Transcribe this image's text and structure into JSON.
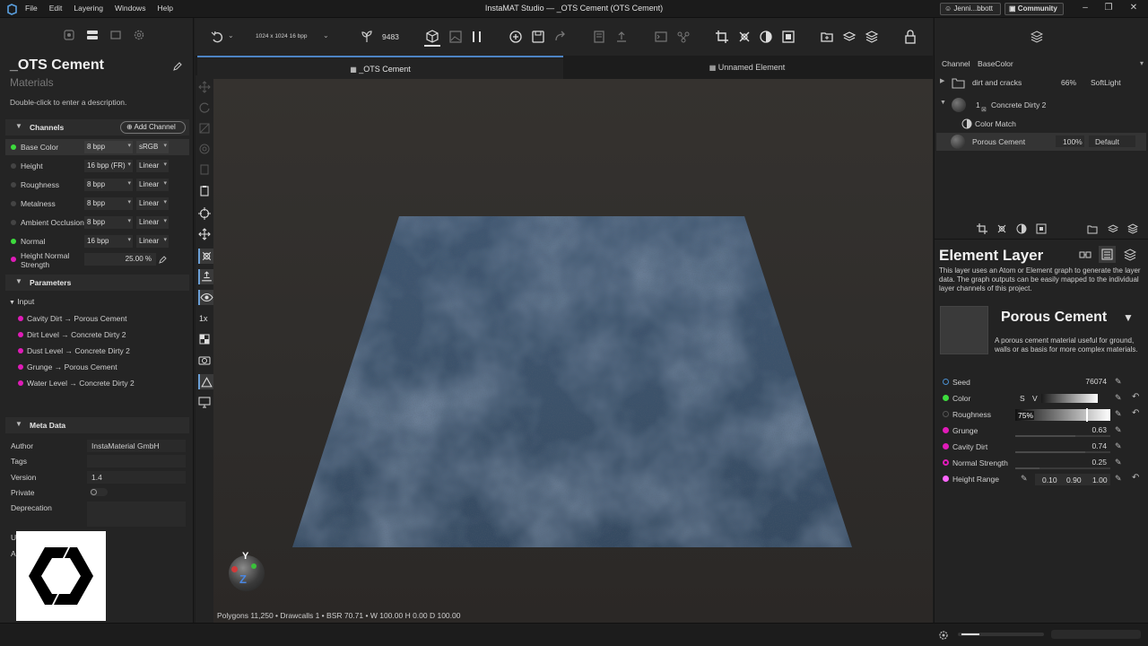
{
  "app": {
    "title": "InstaMAT Studio — _OTS Cement (OTS Cement)",
    "menu": [
      "File",
      "Edit",
      "Layering",
      "Windows",
      "Help"
    ],
    "user_label": "Jenni...bbott",
    "community_label": "Community"
  },
  "document": {
    "title": "_OTS Cement",
    "subtitle": "Materials",
    "description": "Double-click to enter a description."
  },
  "channels": {
    "header": "Channels",
    "add_label": "Add Channel",
    "items": [
      {
        "name": "Base Color",
        "bpp": "8 bpp",
        "space": "sRGB",
        "dot": "#3ddc3d",
        "selected": true
      },
      {
        "name": "Height",
        "bpp": "16 bpp (FR)",
        "space": "Linear",
        "dot": "#444444",
        "selected": false
      },
      {
        "name": "Roughness",
        "bpp": "8 bpp",
        "space": "Linear",
        "dot": "#444444",
        "selected": false
      },
      {
        "name": "Metalness",
        "bpp": "8 bpp",
        "space": "Linear",
        "dot": "#444444",
        "selected": false
      },
      {
        "name": "Ambient Occlusion",
        "bpp": "8 bpp",
        "space": "Linear",
        "dot": "#444444",
        "selected": false
      },
      {
        "name": "Normal",
        "bpp": "16 bpp",
        "space": "Linear",
        "dot": "#3ddc3d",
        "selected": false
      }
    ],
    "height_normal": {
      "label_line1": "Height Normal",
      "label_line2": "Strength",
      "value": "25.00 %"
    }
  },
  "parameters": {
    "header": "Parameters",
    "group": "Input",
    "items": [
      "Cavity Dirt → Porous Cement",
      "Dirt Level → Concrete Dirty 2",
      "Dust Level → Concrete Dirty 2",
      "Grunge → Porous Cement",
      "Water Level → Concrete Dirty 2"
    ]
  },
  "metadata": {
    "header": "Meta Data",
    "author_label": "Author",
    "author": "InstaMaterial GmbH",
    "tags_label": "Tags",
    "tags": "",
    "version_label": "Version",
    "version": "1.4",
    "private_label": "Private",
    "deprecation_label": "Deprecation",
    "u_label": "U",
    "a_label": "A"
  },
  "toolbar": {
    "resolution": "1024 x 1024 16 bpp",
    "seed_count": "9483"
  },
  "tabs": [
    "_OTS Cement",
    "Unnamed Element"
  ],
  "viewport": {
    "status": "Polygons 11,250 • Drawcalls 1 • BSR 70.71 • W 100.00 H 0.00 D 100.00",
    "gizmo": {
      "y": "Y",
      "z": "Z"
    }
  },
  "layers": {
    "channel_label": "Channel",
    "channel_value": "BaseColor",
    "rows": [
      {
        "name": "dirt and cracks",
        "opacity": "66%",
        "blend": "SoftLight",
        "kind": "folder"
      },
      {
        "name": "Concrete Dirty 2",
        "index": "1",
        "kind": "element"
      },
      {
        "name": "Color Match",
        "kind": "filter"
      },
      {
        "name": "Porous Cement",
        "opacity": "100%",
        "blend": "Default",
        "kind": "element"
      }
    ]
  },
  "element_layer": {
    "title": "Element Layer",
    "description": "This layer uses an Atom or Element graph to generate the layer data. The graph outputs can be easily mapped to the individual layer channels of this project.",
    "material_name": "Porous Cement",
    "material_desc": "A porous cement material useful for ground, walls or as basis for more complex materials.",
    "props": [
      {
        "name": "Seed",
        "value": "76074",
        "dot": "#4a8fcf",
        "fill": 0
      },
      {
        "name": "Color",
        "value": "",
        "dot": "#3ddc3d",
        "fill": 0
      },
      {
        "name": "Roughness",
        "value": "75%",
        "dot": "#555555",
        "fill": 0.75
      },
      {
        "name": "Grunge",
        "value": "0.63",
        "dot": "#e01bb8",
        "fill": 0.63
      },
      {
        "name": "Cavity Dirt",
        "value": "0.74",
        "dot": "#e01bb8",
        "fill": 0.74
      },
      {
        "name": "Normal Strength",
        "value": "0.25",
        "dot": "#e01bb8",
        "fill": 0.25
      },
      {
        "name": "Height Range",
        "value": "",
        "dot": "#ff66ff",
        "fill": 0
      }
    ],
    "color_sv": {
      "s": "S",
      "v": "V"
    },
    "height_range": {
      "min": "0.10",
      "mid": "0.90",
      "max": "1.00"
    }
  }
}
